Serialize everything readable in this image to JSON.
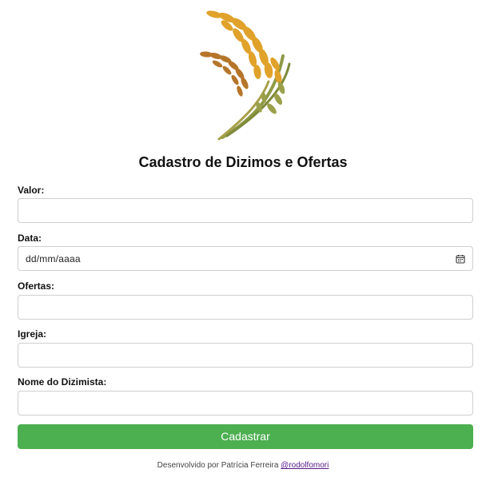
{
  "header": {
    "logo_icon": "wheat-logo-icon",
    "title": "Cadastro de Dizimos e Ofertas"
  },
  "form": {
    "fields": [
      {
        "label": "Valor:",
        "value": "",
        "placeholder": ""
      },
      {
        "label": "Data:",
        "value": "",
        "placeholder": "dd/mm/aaaa",
        "icon": "calendar-icon"
      },
      {
        "label": "Ofertas:",
        "value": "",
        "placeholder": ""
      },
      {
        "label": "Igreja:",
        "value": "",
        "placeholder": ""
      },
      {
        "label": "Nome do Dizimista:",
        "value": "",
        "placeholder": ""
      }
    ],
    "submit_label": "Cadastrar"
  },
  "footer": {
    "text": "Desenvolvido por Patrícia Ferreira",
    "link_text": "@rodolfomori"
  },
  "colors": {
    "button": "#4caf50",
    "wheat_gold": "#e0a22a",
    "wheat_brown": "#b5762a",
    "wheat_olive": "#8f9a45",
    "link": "#551a8b"
  }
}
